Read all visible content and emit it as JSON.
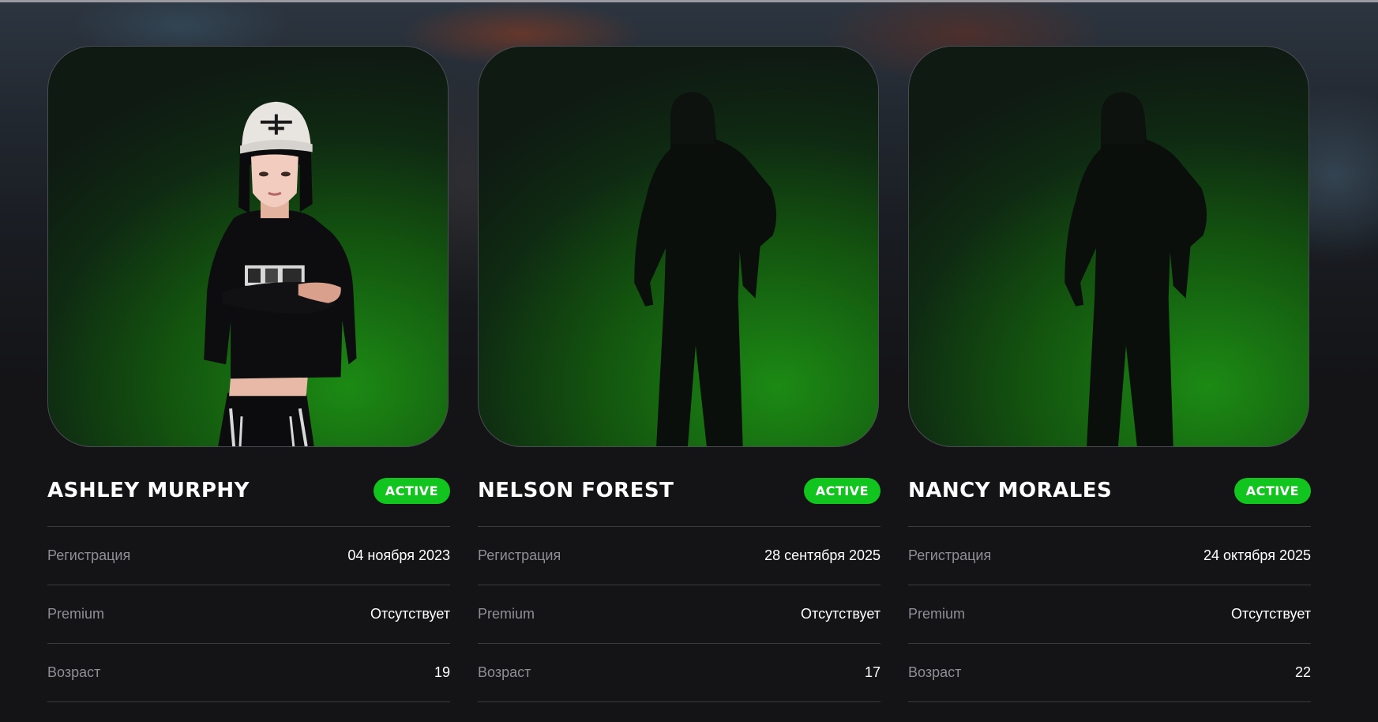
{
  "players": [
    {
      "name": "ASHLEY MURPHY",
      "status": "ACTIVE",
      "rows": [
        {
          "label": "Регистрация",
          "value": "04 ноября 2023"
        },
        {
          "label": "Premium",
          "value": "Отсутствует"
        },
        {
          "label": "Возраст",
          "value": "19"
        }
      ]
    },
    {
      "name": "NELSON FOREST",
      "status": "ACTIVE",
      "rows": [
        {
          "label": "Регистрация",
          "value": "28 сентября 2025"
        },
        {
          "label": "Premium",
          "value": "Отсутствует"
        },
        {
          "label": "Возраст",
          "value": "17"
        }
      ]
    },
    {
      "name": "NANCY MORALES",
      "status": "ACTIVE",
      "rows": [
        {
          "label": "Регистрация",
          "value": "24 октября 2025"
        },
        {
          "label": "Premium",
          "value": "Отсутствует"
        },
        {
          "label": "Возраст",
          "value": "22"
        }
      ]
    }
  ],
  "colors": {
    "status_active": "#12c41e",
    "page_background": "#141417",
    "avatar_background": "#1c8a14"
  }
}
